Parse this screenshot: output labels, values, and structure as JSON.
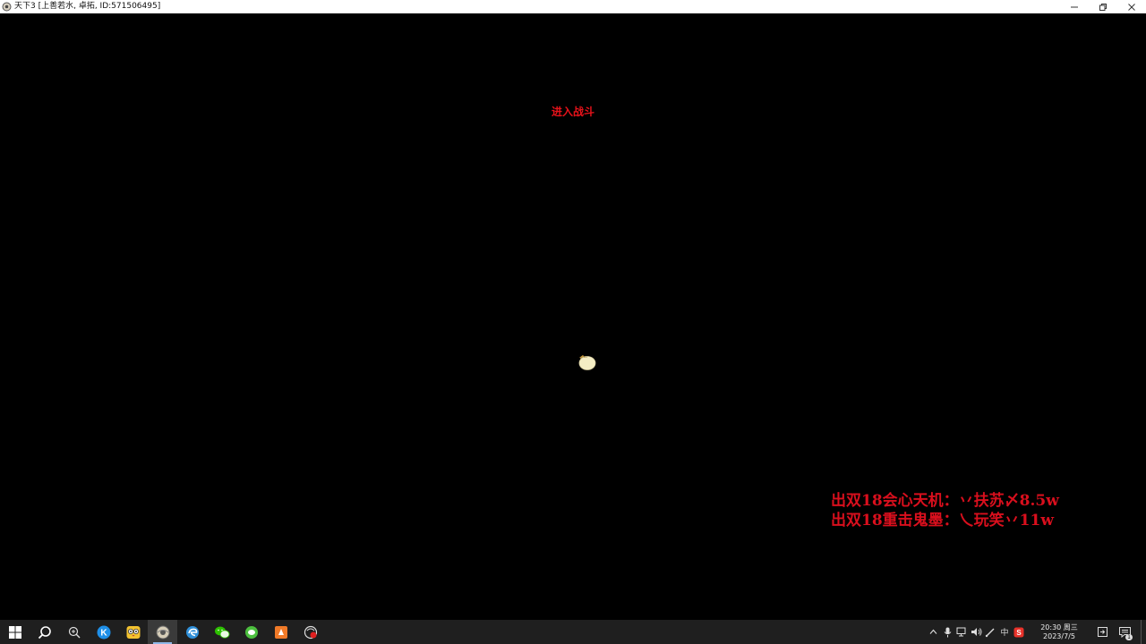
{
  "window": {
    "title": "天下3 [上善若水, 卓拓, ID:571506495]",
    "controls": [
      "minimize-icon",
      "restore-icon",
      "close-icon"
    ]
  },
  "game": {
    "status_text": "进入战斗",
    "promo_lines": [
      "出双18会心天机：丷扶苏〆8.5w",
      "出双18重击鬼墨：乀玩笑丷11w"
    ],
    "colors": {
      "status": "#e8121a",
      "promo": "#d90f1d",
      "background": "#000000"
    }
  },
  "taskbar": {
    "pinned": [
      {
        "name": "start-icon"
      },
      {
        "name": "search-icon"
      },
      {
        "name": "zoom-search-icon"
      },
      {
        "name": "k-app-icon"
      },
      {
        "name": "owl-app-icon"
      },
      {
        "name": "tianxia-game-icon",
        "active": true
      },
      {
        "name": "edge-browser-icon"
      },
      {
        "name": "wechat-icon"
      },
      {
        "name": "green-chat-icon"
      },
      {
        "name": "orange-app-icon"
      },
      {
        "name": "screen-recorder-icon"
      }
    ],
    "tray": {
      "ime": "中",
      "icons": [
        "chevron-up-icon",
        "microphone-icon",
        "network-icon",
        "volume-icon",
        "pen-icon",
        "ime-icon",
        "sogou-icon"
      ]
    },
    "clock": {
      "time": "20:30 周三",
      "date": "2023/7/5"
    },
    "notification_count": "1"
  }
}
